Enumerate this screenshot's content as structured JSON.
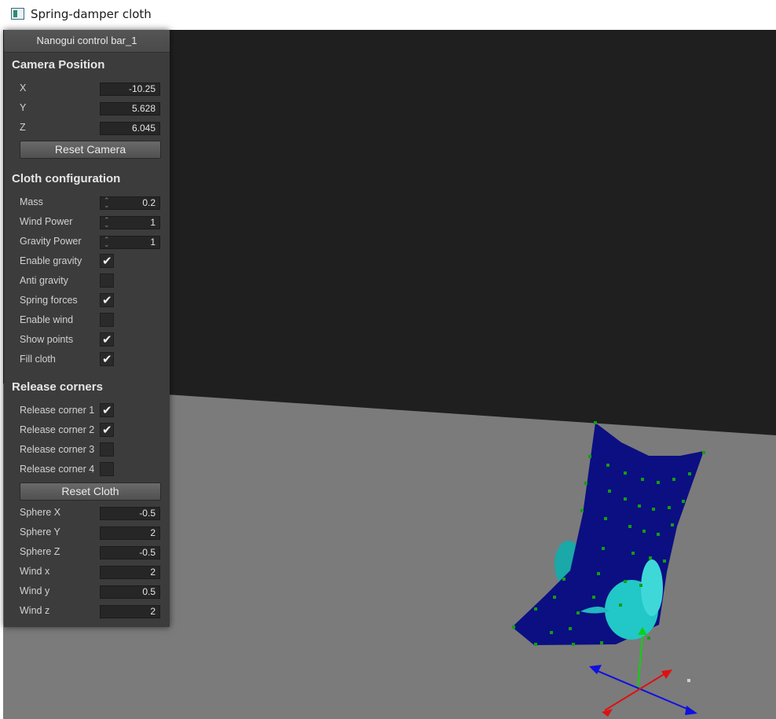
{
  "window": {
    "title": "Spring-damper cloth"
  },
  "panel": {
    "title": "Nanogui control bar_1",
    "camera": {
      "heading": "Camera Position",
      "x_label": "X",
      "x_value": "-10.25",
      "y_label": "Y",
      "y_value": "5.628",
      "z_label": "Z",
      "z_value": "6.045",
      "reset_label": "Reset Camera"
    },
    "cloth": {
      "heading": "Cloth configuration",
      "mass_label": "Mass",
      "mass_value": "0.2",
      "wind_power_label": "Wind Power",
      "wind_power_value": "1",
      "gravity_power_label": "Gravity Power",
      "gravity_power_value": "1",
      "enable_gravity_label": "Enable gravity",
      "enable_gravity": true,
      "anti_gravity_label": "Anti gravity",
      "anti_gravity": false,
      "spring_forces_label": "Spring forces",
      "spring_forces": true,
      "enable_wind_label": "Enable wind",
      "enable_wind": false,
      "show_points_label": "Show points",
      "show_points": true,
      "fill_cloth_label": "Fill cloth",
      "fill_cloth": true
    },
    "release": {
      "heading": "Release corners",
      "corner1_label": "Release corner 1",
      "corner1": true,
      "corner2_label": "Release corner 2",
      "corner2": true,
      "corner3_label": "Release corner 3",
      "corner3": false,
      "corner4_label": "Release corner 4",
      "corner4": false,
      "reset_label": "Reset Cloth",
      "sphere_x_label": "Sphere X",
      "sphere_x_value": "-0.5",
      "sphere_y_label": "Sphere Y",
      "sphere_y_value": "2",
      "sphere_z_label": "Sphere Z",
      "sphere_z_value": "-0.5",
      "wind_x_label": "Wind x",
      "wind_x_value": "2",
      "wind_y_label": "Wind y",
      "wind_y_value": "0.5",
      "wind_z_label": "Wind z",
      "wind_z_value": "2"
    }
  },
  "colors": {
    "sky": "#1f1f1f",
    "floor": "#7b7b7b",
    "cloth": "#0b0f82",
    "sphere": "#22c7c7",
    "points": "#10a010",
    "axis_x": "#e01010",
    "axis_y": "#10d010",
    "axis_z": "#1010e0"
  }
}
